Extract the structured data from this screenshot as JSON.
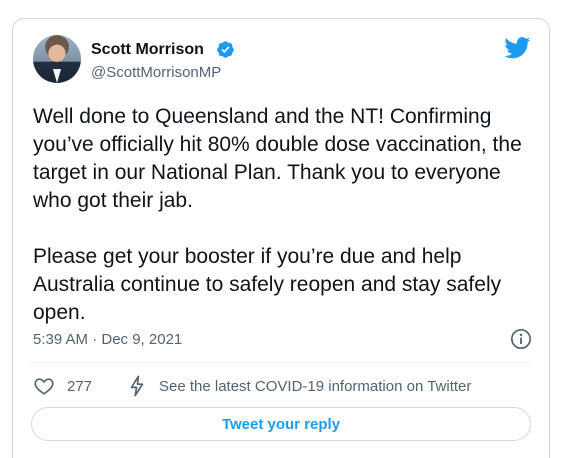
{
  "tweet": {
    "author": {
      "name": "Scott Morrison",
      "handle": "@ScottMorrisonMP",
      "verified": true
    },
    "text": "Well done to Queensland and the NT! Confirming you’ve officially hit 80% double dose vaccination, the target in our National Plan. Thank you to everyone who got their jab.\n\nPlease get your booster if you’re due and help Australia continue to safely reopen and stay safely open.",
    "timestamp": "5:39 AM · Dec 9, 2021",
    "likes": "277",
    "covid_info_link": "See the latest COVID-19 information on Twitter",
    "reply_button_label": "Tweet your reply"
  },
  "icons": {
    "brand": "twitter-bird-icon",
    "verified": "verified-badge-icon",
    "info": "info-icon",
    "like": "heart-icon",
    "covid": "lightning-bolt-icon"
  },
  "colors": {
    "brand_blue": "#1d9bf0",
    "text_primary": "#0f1419",
    "text_secondary": "#536471",
    "border": "#cfd9de"
  }
}
